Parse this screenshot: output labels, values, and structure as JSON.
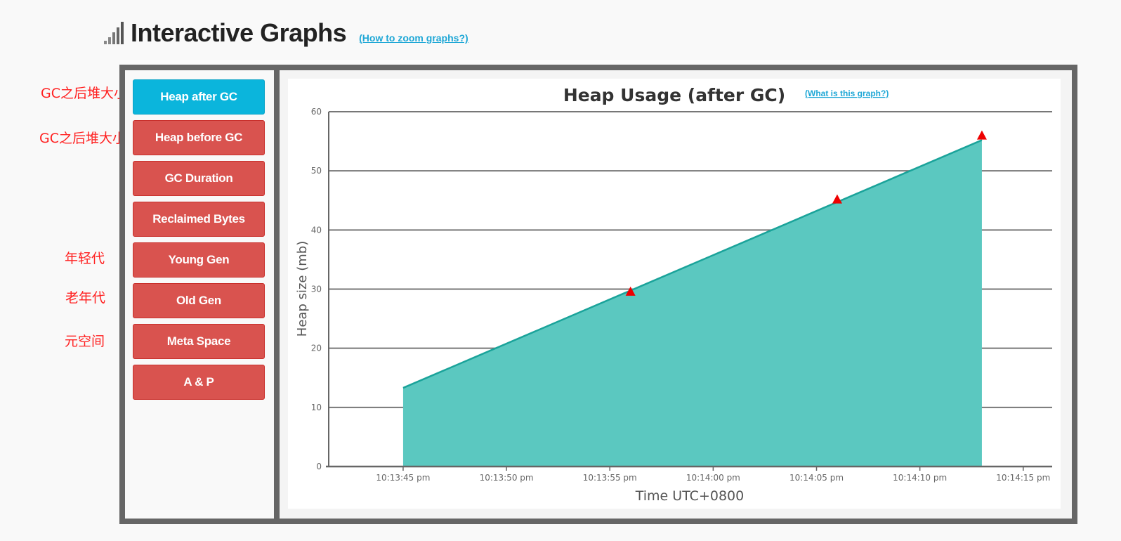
{
  "header": {
    "title": "Interactive Graphs",
    "zoom_link": "(How to zoom graphs?)"
  },
  "nav": [
    {
      "label": "Heap after GC",
      "active": true,
      "color": "#0bb5dc"
    },
    {
      "label": "Heap before GC",
      "active": false,
      "color": "#d9534f"
    },
    {
      "label": "GC Duration",
      "active": false,
      "color": "#d9534f"
    },
    {
      "label": "Reclaimed Bytes",
      "active": false,
      "color": "#d9534f"
    },
    {
      "label": "Young Gen",
      "active": false,
      "color": "#d9534f"
    },
    {
      "label": "Old Gen",
      "active": false,
      "color": "#d9534f"
    },
    {
      "label": "Meta Space",
      "active": false,
      "color": "#d9534f"
    },
    {
      "label": "A & P",
      "active": false,
      "color": "#d9534f"
    }
  ],
  "annotations": [
    "GC之后堆大小",
    "GC之后堆大小",
    "年轻代",
    "老年代",
    "元空间"
  ],
  "chart_help_link": "(What is this graph?)",
  "chart_data": {
    "type": "area",
    "title": "Heap Usage (after GC)",
    "xlabel": "Time UTC+0800",
    "ylabel": "Heap size (mb)",
    "ylim": [
      0,
      60
    ],
    "yticks": [
      0,
      10,
      20,
      30,
      40,
      50,
      60
    ],
    "xticks": [
      "10:13:45 pm",
      "10:13:50 pm",
      "10:13:55 pm",
      "10:14:00 pm",
      "10:14:05 pm",
      "10:14:10 pm",
      "10:14:15 pm"
    ],
    "xlim": [
      "10:13:41.4 pm",
      "10:14:16.4 pm"
    ],
    "series": [
      {
        "x": [
          "10:13:45 pm",
          "10:14:13 pm"
        ],
        "y": [
          13.3,
          55.2
        ],
        "color": "#5bc8c0",
        "line_color": "#1aa39a"
      }
    ],
    "markers": [
      {
        "x": "10:13:56 pm",
        "y": 29.6
      },
      {
        "x": "10:14:06 pm",
        "y": 45.2
      },
      {
        "x": "10:14:13 pm",
        "y": 56.0
      }
    ],
    "marker_color": "#ee0000",
    "grid": true
  }
}
